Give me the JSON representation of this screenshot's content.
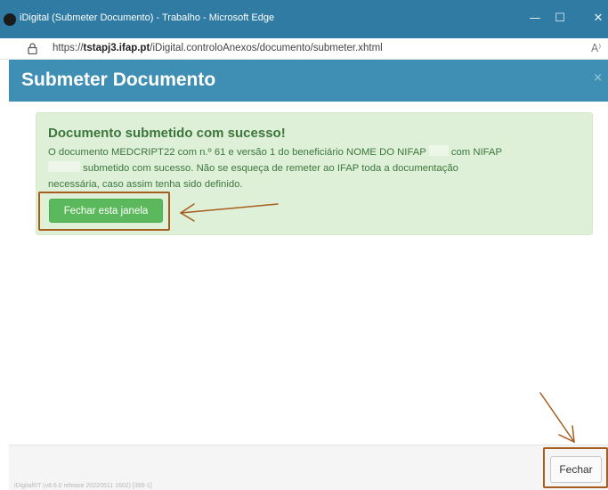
{
  "window": {
    "title": "iDigital (Submeter Documento) - Trabalho - Microsoft Edge",
    "controls": {
      "minimize": "—",
      "maximize": "☐",
      "close": "✕"
    }
  },
  "address": {
    "prefix": "https://",
    "host": "tstapj3.ifap.pt",
    "path": "/iDigital.controloAnexos/documento/submeter.xhtml",
    "read_aloud": "A⁾"
  },
  "dialog": {
    "title": "Submeter Documento",
    "close_glyph": "×",
    "alert": {
      "heading": "Documento submetido com sucesso!",
      "line1_a": "O documento MEDCRIPT22 com n.º 61 e versão 1 do beneficiário NOME DO NIFAP",
      "line1_b": "com NIFAP",
      "line2": "submetido com sucesso. Não se esqueça de remeter ao IFAP toda a documentação",
      "line3": "necessária, caso assim tenha sido definido.",
      "button_label": "Fechar esta janela"
    },
    "footer": {
      "version": "iDigital®T (v8.6.0 release 20220511 1602) [395-1]",
      "close_label": "Fechar"
    }
  },
  "annotation_color": "#a65d1d"
}
